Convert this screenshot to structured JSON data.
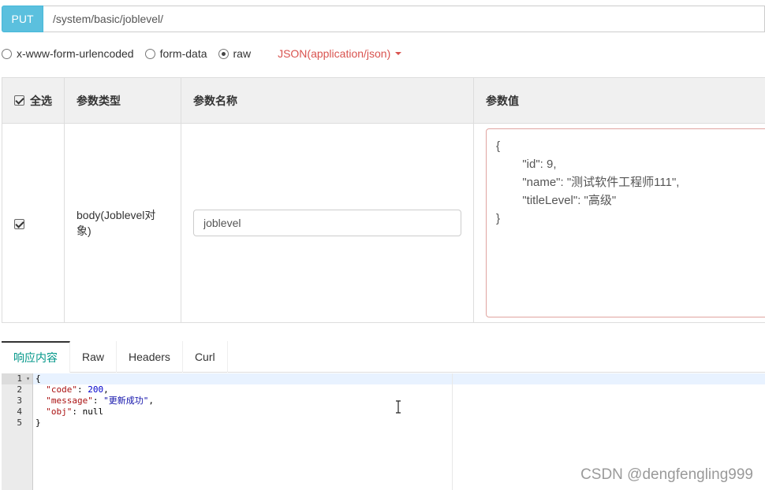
{
  "request": {
    "method": "PUT",
    "url": "/system/basic/joblevel/"
  },
  "body_types": [
    {
      "label": "x-www-form-urlencoded",
      "checked": false
    },
    {
      "label": "form-data",
      "checked": false
    },
    {
      "label": "raw",
      "checked": true
    }
  ],
  "content_type": "JSON(application/json)",
  "params_table": {
    "headers": {
      "select_all": "全选",
      "param_type": "参数类型",
      "param_name": "参数名称",
      "param_value": "参数值"
    },
    "rows": [
      {
        "checked": true,
        "type": "body(Joblevel对象)",
        "name": "joblevel",
        "value": "{\n        \"id\": 9,\n        \"name\": \"测试软件工程师111\",\n        \"titleLevel\": \"高级\"\n}"
      }
    ]
  },
  "response_tabs": [
    "响应内容",
    "Raw",
    "Headers",
    "Curl"
  ],
  "active_response_tab": "响应内容",
  "response_lines": [
    {
      "num": "1",
      "text": "{"
    },
    {
      "num": "2",
      "key": "\"code\"",
      "val": "200",
      "val_type": "number",
      "suffix": ","
    },
    {
      "num": "3",
      "key": "\"message\"",
      "val": "\"更新成功\"",
      "val_type": "string",
      "suffix": ","
    },
    {
      "num": "4",
      "key": "\"obj\"",
      "val": "null",
      "val_type": "plain",
      "suffix": ""
    },
    {
      "num": "5",
      "text": "}"
    }
  ],
  "watermark": "CSDN @dengfengling999",
  "colors": {
    "method_button": "#5bc0de",
    "content_type": "#d9534f",
    "active_tab": "#009688"
  }
}
